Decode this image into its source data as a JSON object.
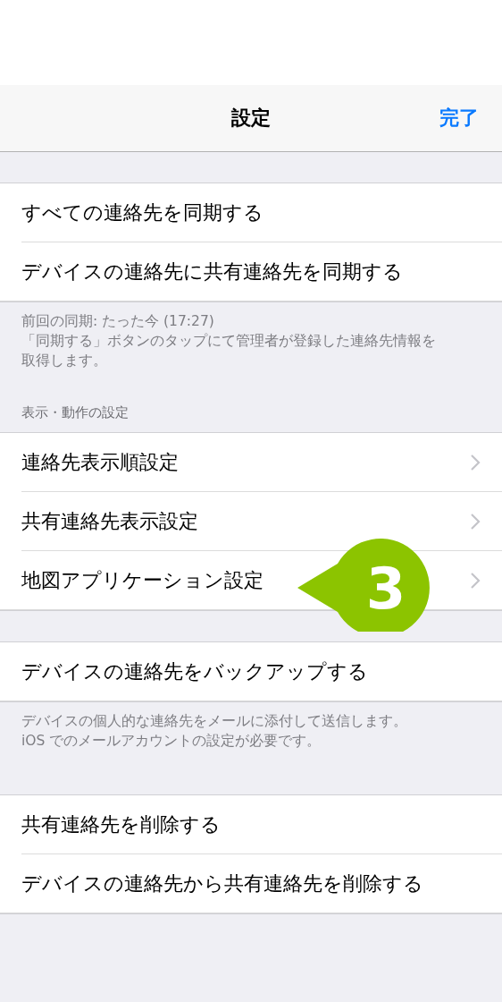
{
  "nav_bar": {
    "title": "設定",
    "done_button": "完了"
  },
  "sections": [
    {
      "rows": [
        {
          "kind": "action",
          "label": "すべての連絡先を同期する"
        },
        {
          "kind": "action",
          "label": "デバイスの連絡先に共有連絡先を同期する"
        }
      ],
      "footer": [
        "前回の同期: たった今 (17:27)",
        "「同期する」ボタンのタップにて管理者が登録した連絡先情報を取得します。"
      ]
    },
    {
      "header": "表示・動作の設定",
      "rows": [
        {
          "kind": "link",
          "label": "連絡先表示順設定"
        },
        {
          "kind": "link",
          "label": "共有連絡先表示設定"
        },
        {
          "kind": "link",
          "label": "地図アプリケーション設定",
          "callout": "3"
        }
      ]
    },
    {
      "rows": [
        {
          "kind": "action",
          "label": "デバイスの連絡先をバックアップする"
        }
      ],
      "footer": [
        "デバイスの個人的な連絡先をメールに添付して送信します。",
        "iOS でのメールアカウントの設定が必要です。"
      ]
    },
    {
      "rows": [
        {
          "kind": "action",
          "label": "共有連絡先を削除する"
        },
        {
          "kind": "action",
          "label": "デバイスの連絡先から共有連絡先を削除する"
        }
      ]
    }
  ]
}
